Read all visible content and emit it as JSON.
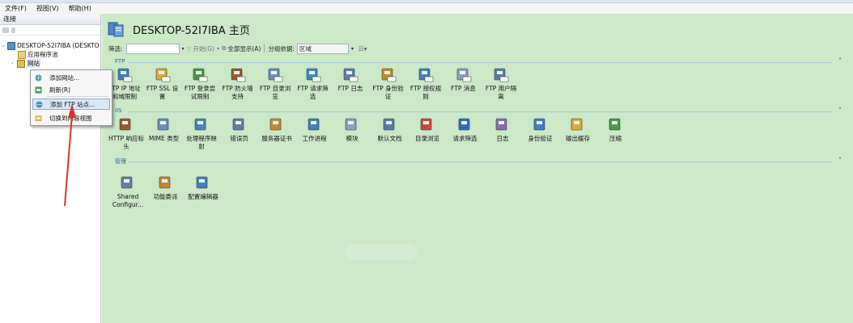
{
  "menubar": {
    "items": [
      "文件(F)",
      "视图(V)",
      "帮助(H)"
    ]
  },
  "connections": {
    "header": "连接",
    "tree": {
      "server": "DESKTOP-52I7IBA (DESKTO",
      "app_pools": "应用程序池",
      "sites": "网站"
    }
  },
  "context_menu": {
    "items": [
      "添加网站...",
      "刷新(R)",
      "添加 FTP 站点...",
      "切换到内容视图"
    ]
  },
  "main": {
    "title": "DESKTOP-52I7IBA 主页",
    "filter": {
      "label": "筛选:",
      "go": "开始(G)",
      "show_all": "全部显示(A)",
      "group_by_label": "分组依据:",
      "group_by_value": "区域"
    },
    "groups": [
      {
        "name": "FTP",
        "features": [
          {
            "l1": "FTP IP 地址",
            "l2": "和域限制",
            "icon": "ftp-ip-icon"
          },
          {
            "l1": "FTP SSL 设",
            "l2": "置",
            "icon": "ftp-ssl-icon"
          },
          {
            "l1": "FTP 登录尝",
            "l2": "试限制",
            "icon": "ftp-logon-icon"
          },
          {
            "l1": "FTP 防火墙",
            "l2": "支持",
            "icon": "ftp-firewall-icon"
          },
          {
            "l1": "FTP 目录浏",
            "l2": "览",
            "icon": "ftp-dir-icon"
          },
          {
            "l1": "FTP 请求筛",
            "l2": "选",
            "icon": "ftp-request-icon"
          },
          {
            "l1": "FTP 日志",
            "l2": "",
            "icon": "ftp-log-icon"
          },
          {
            "l1": "FTP 身份验",
            "l2": "证",
            "icon": "ftp-auth-icon"
          },
          {
            "l1": "FTP 授权规",
            "l2": "则",
            "icon": "ftp-authz-icon"
          },
          {
            "l1": "FTP 消息",
            "l2": "",
            "icon": "ftp-message-icon"
          },
          {
            "l1": "FTP 用户隔",
            "l2": "离",
            "icon": "ftp-isolation-icon"
          }
        ]
      },
      {
        "name": "IIS",
        "features": [
          {
            "l1": "HTTP 响应标",
            "l2": "头",
            "icon": "http-headers-icon"
          },
          {
            "l1": "MIME 类型",
            "l2": "",
            "icon": "mime-icon"
          },
          {
            "l1": "处理程序映",
            "l2": "射",
            "icon": "handler-icon"
          },
          {
            "l1": "错误页",
            "l2": "",
            "icon": "error-page-icon"
          },
          {
            "l1": "服务器证书",
            "l2": "",
            "icon": "cert-icon"
          },
          {
            "l1": "工作进程",
            "l2": "",
            "icon": "worker-icon"
          },
          {
            "l1": "模块",
            "l2": "",
            "icon": "modules-icon"
          },
          {
            "l1": "默认文档",
            "l2": "",
            "icon": "default-doc-icon"
          },
          {
            "l1": "目录浏览",
            "l2": "",
            "icon": "dir-browse-icon"
          },
          {
            "l1": "请求筛选",
            "l2": "",
            "icon": "request-filter-icon"
          },
          {
            "l1": "日志",
            "l2": "",
            "icon": "log-icon"
          },
          {
            "l1": "身份验证",
            "l2": "",
            "icon": "auth-icon"
          },
          {
            "l1": "输出缓存",
            "l2": "",
            "icon": "output-cache-icon"
          },
          {
            "l1": "压缩",
            "l2": "",
            "icon": "compression-icon"
          }
        ]
      },
      {
        "name": "管理",
        "features": [
          {
            "l1": "Shared",
            "l2": "Configur...",
            "icon": "shared-config-icon"
          },
          {
            "l1": "功能委派",
            "l2": "",
            "icon": "delegation-icon"
          },
          {
            "l1": "配置编辑器",
            "l2": "",
            "icon": "config-editor-icon"
          }
        ]
      }
    ]
  },
  "colors": {
    "content_bg": "#cbe8c7",
    "arrow": "#d9342b",
    "selection": "#d9e8f7"
  }
}
